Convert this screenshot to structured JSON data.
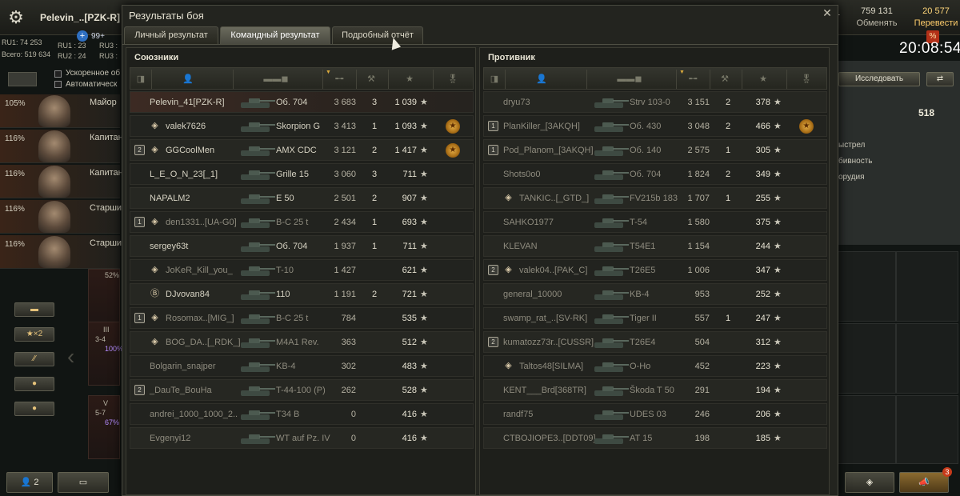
{
  "window": {
    "title": "Результаты боя",
    "close_icon": "close-icon"
  },
  "tabs": [
    {
      "label": "Личный результат",
      "active": false
    },
    {
      "label": "Командный результат",
      "active": true
    },
    {
      "label": "Подробный отчёт",
      "active": false
    }
  ],
  "allies": {
    "title": "Союзники",
    "rows": [
      {
        "badge": "",
        "rank": "",
        "name": "Pelevin_41[PZK-R]",
        "tank": "Об. 704",
        "damage": "3 683",
        "frags": "3",
        "xp": "1 039",
        "medal": "",
        "style": "self"
      },
      {
        "badge": "",
        "rank": "◈",
        "name": "valek7626",
        "tank": "Skorpion G",
        "damage": "3 413",
        "frags": "1",
        "xp": "1 093",
        "medal": "★",
        "style": ""
      },
      {
        "badge": "2",
        "rank": "◈",
        "name": "GGCoolMen",
        "tank": "AMX CDC",
        "damage": "3 121",
        "frags": "2",
        "xp": "1 417",
        "medal": "★",
        "style": ""
      },
      {
        "badge": "",
        "rank": "",
        "name": "L_E_O_N_23[_1]",
        "tank": "Grille 15",
        "damage": "3 060",
        "frags": "3",
        "xp": "711",
        "medal": "",
        "style": ""
      },
      {
        "badge": "",
        "rank": "",
        "name": "NAPALM2",
        "tank": "E 50",
        "damage": "2 501",
        "frags": "2",
        "xp": "907",
        "medal": "",
        "style": ""
      },
      {
        "badge": "1",
        "rank": "◈",
        "name": "den1331..[UA-G0]",
        "tank": "B-C 25 t",
        "damage": "2 434",
        "frags": "1",
        "xp": "693",
        "medal": "",
        "style": "dead"
      },
      {
        "badge": "",
        "rank": "",
        "name": "sergey63t",
        "tank": "Об. 704",
        "damage": "1 937",
        "frags": "1",
        "xp": "711",
        "medal": "",
        "style": ""
      },
      {
        "badge": "",
        "rank": "◈",
        "name": "JoKeR_Kill_you_",
        "tank": "T-10",
        "damage": "1 427",
        "frags": "",
        "xp": "621",
        "medal": "",
        "style": "dead"
      },
      {
        "badge": "",
        "rank": "Ⓑ",
        "name": "DJvovan84",
        "tank": "110",
        "damage": "1 191",
        "frags": "2",
        "xp": "721",
        "medal": "",
        "style": ""
      },
      {
        "badge": "1",
        "rank": "◈",
        "name": "Rosomax..[MIG_]",
        "tank": "B-C 25 t",
        "damage": "784",
        "frags": "",
        "xp": "535",
        "medal": "",
        "style": "dead"
      },
      {
        "badge": "",
        "rank": "◈",
        "name": "BOG_DA..[_RDK_]",
        "tank": "M4A1 Rev.",
        "damage": "363",
        "frags": "",
        "xp": "512",
        "medal": "",
        "style": "dead"
      },
      {
        "badge": "",
        "rank": "",
        "name": "Bolgarin_snajper",
        "tank": "KB-4",
        "damage": "302",
        "frags": "",
        "xp": "483",
        "medal": "",
        "style": "dead"
      },
      {
        "badge": "2",
        "rank": "",
        "name": "_DauTe_BouHa",
        "tank": "T-44-100 (P)",
        "damage": "262",
        "frags": "",
        "xp": "528",
        "medal": "",
        "style": "dead"
      },
      {
        "badge": "",
        "rank": "",
        "name": "andrei_1000_1000_2..",
        "tank": "T34 B",
        "damage": "0",
        "frags": "",
        "xp": "416",
        "medal": "",
        "style": "dead"
      },
      {
        "badge": "",
        "rank": "",
        "name": "Evgenyi12",
        "tank": "WT auf Pz. IV",
        "damage": "0",
        "frags": "",
        "xp": "416",
        "medal": "",
        "style": "dead"
      }
    ]
  },
  "enemies": {
    "title": "Противник",
    "rows": [
      {
        "badge": "",
        "rank": "",
        "name": "dryu73",
        "tank": "Strv 103-0",
        "damage": "3 151",
        "frags": "2",
        "xp": "378",
        "medal": "",
        "style": "dead"
      },
      {
        "badge": "1",
        "rank": "",
        "name": "PlanKiller_[3AKQH]",
        "tank": "Об. 430",
        "damage": "3 048",
        "frags": "2",
        "xp": "466",
        "medal": "★",
        "style": "dead"
      },
      {
        "badge": "1",
        "rank": "",
        "name": "Pod_Planom_[3AKQH]",
        "tank": "Об. 140",
        "damage": "2 575",
        "frags": "1",
        "xp": "305",
        "medal": "",
        "style": "dead"
      },
      {
        "badge": "",
        "rank": "",
        "name": "Shots0o0",
        "tank": "Об. 704",
        "damage": "1 824",
        "frags": "2",
        "xp": "349",
        "medal": "",
        "style": "dead"
      },
      {
        "badge": "",
        "rank": "◈",
        "name": "TANKIC..[_GTD_]",
        "tank": "FV215b 183",
        "damage": "1 707",
        "frags": "1",
        "xp": "255",
        "medal": "",
        "style": "dead"
      },
      {
        "badge": "",
        "rank": "",
        "name": "SAHKO1977",
        "tank": "T-54",
        "damage": "1 580",
        "frags": "",
        "xp": "375",
        "medal": "",
        "style": "dead"
      },
      {
        "badge": "",
        "rank": "",
        "name": "KLEVAN",
        "tank": "T54E1",
        "damage": "1 154",
        "frags": "",
        "xp": "244",
        "medal": "",
        "style": "dead"
      },
      {
        "badge": "2",
        "rank": "◈",
        "name": "valek04..[PAK_C]",
        "tank": "T26E5",
        "damage": "1 006",
        "frags": "",
        "xp": "347",
        "medal": "",
        "style": "dead"
      },
      {
        "badge": "",
        "rank": "",
        "name": "general_10000",
        "tank": "KB-4",
        "damage": "953",
        "frags": "",
        "xp": "252",
        "medal": "",
        "style": "dead"
      },
      {
        "badge": "",
        "rank": "",
        "name": "swamp_rat_..[SV-RK]",
        "tank": "Tiger II",
        "damage": "557",
        "frags": "1",
        "xp": "247",
        "medal": "",
        "style": "dead"
      },
      {
        "badge": "2",
        "rank": "",
        "name": "kumatozz73r..[CUSSR]",
        "tank": "T26E4",
        "damage": "504",
        "frags": "",
        "xp": "312",
        "medal": "",
        "style": "dead"
      },
      {
        "badge": "",
        "rank": "◈",
        "name": "Taltos48[SILMA]",
        "tank": "O-Ho",
        "damage": "452",
        "frags": "",
        "xp": "223",
        "medal": "",
        "style": "dead"
      },
      {
        "badge": "",
        "rank": "",
        "name": "KENT___Brd[368TR]",
        "tank": "Škoda T 50",
        "damage": "291",
        "frags": "",
        "xp": "194",
        "medal": "",
        "style": "dead"
      },
      {
        "badge": "",
        "rank": "",
        "name": "randf75",
        "tank": "UDES 03",
        "damage": "246",
        "frags": "",
        "xp": "206",
        "medal": "",
        "style": "dead"
      },
      {
        "badge": "",
        "rank": "",
        "name": "CTBOJIOPE3..[DDT09]",
        "tank": "AT 15",
        "damage": "198",
        "frags": "",
        "xp": "185",
        "medal": "",
        "style": "dead"
      }
    ]
  },
  "header": {
    "player": "Pelevin_..[PZK-R]",
    "stats": [
      "RU1: 74 253",
      "Всего: 519 634",
      "RU1 : 23",
      "RU2 : 24",
      "RU3 :",
      "RU3 :"
    ],
    "plus_value": "99+",
    "credits_left": "1",
    "credits": "759 131",
    "credits_action": "Обменять",
    "gold": "20 577",
    "gold_action": "Перевести",
    "premium_badge": "%",
    "clock": "20:08:54"
  },
  "left_panel": {
    "checkboxes": [
      "Ускоренное об",
      "Автоматическ"
    ],
    "crew": [
      {
        "pct": "105%",
        "rank": "Майор"
      },
      {
        "pct": "116%",
        "rank": "Капитан"
      },
      {
        "pct": "116%",
        "rank": "Капитан"
      },
      {
        "pct": "116%",
        "rank": "Старши"
      },
      {
        "pct": "116%",
        "rank": "Старши"
      }
    ],
    "mini_labels": [
      "52%",
      "III",
      "3-4",
      "100%",
      "V",
      "5-7",
      "67%"
    ],
    "multiplier": "★×2",
    "bottom_count": "2"
  },
  "right_panel": {
    "research_btn": "Исследовать",
    "xp_value": "518",
    "lines": [
      "ыстрел",
      "бивность",
      "орудия"
    ],
    "notify_count": "3"
  }
}
